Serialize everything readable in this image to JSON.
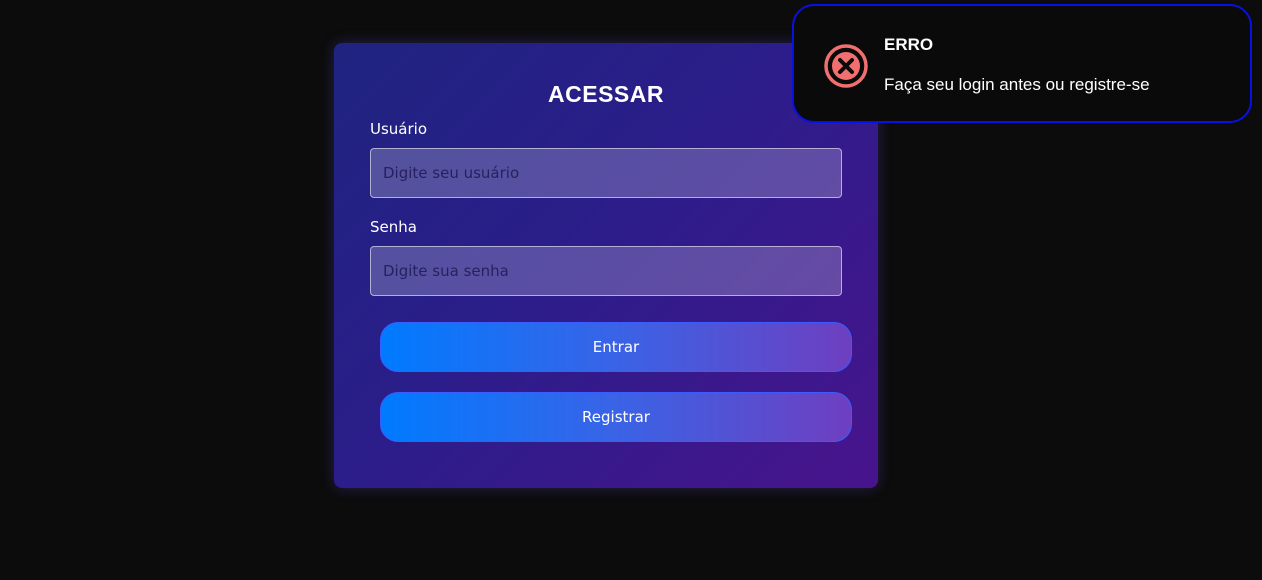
{
  "login": {
    "title": "ACESSAR",
    "username_label": "Usuário",
    "username_value": "",
    "username_placeholder": "Digite seu usuário",
    "password_label": "Senha",
    "password_value": "",
    "password_placeholder": "Digite sua senha",
    "login_button": "Entrar",
    "register_button": "Registrar"
  },
  "toast": {
    "title": "ERRO",
    "message": "Faça seu login antes ou registre-se",
    "icon": "error-x-circle-icon",
    "icon_color": "#f26f6f",
    "border_color": "#0a10e0"
  },
  "colors": {
    "background": "#0c0c0c",
    "button_gradient_start": "#007bff",
    "button_gradient_end": "#6e3fc0"
  }
}
